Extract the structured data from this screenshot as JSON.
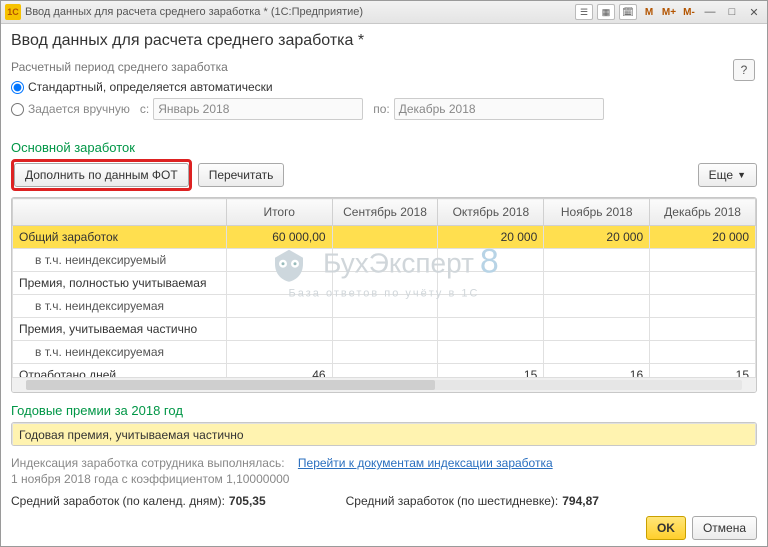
{
  "titlebar": {
    "logo_text": "1C",
    "title": "Ввод данных для расчета среднего заработка * (1С:Предприятие)",
    "m_labels": [
      "M",
      "M+",
      "M-"
    ]
  },
  "header": "Ввод данных для расчета среднего заработка *",
  "period": {
    "label": "Расчетный период среднего заработка",
    "opt_standard": "Стандартный, определяется автоматически",
    "opt_manual": "Задается вручную",
    "from_label": "с:",
    "to_label": "по:",
    "from_value": "Январь 2018",
    "to_value": "Декабрь 2018"
  },
  "help": "?",
  "main_section": {
    "title": "Основной заработок",
    "btn_fill": "Дополнить по данным ФОТ",
    "btn_recalc": "Перечитать",
    "btn_more": "Еще"
  },
  "chart_data": {
    "type": "table",
    "columns": [
      "",
      "Итого",
      "Сентябрь 2018",
      "Октябрь 2018",
      "Ноябрь 2018",
      "Декабрь 2018"
    ],
    "rows": [
      {
        "name": "Общий заработок",
        "total": "60 000,00",
        "sep": "",
        "oct": "20 000",
        "nov": "20 000",
        "dec": "20 000",
        "cls": "total"
      },
      {
        "name": "в т.ч. неиндексируемый",
        "total": "",
        "sep": "",
        "oct": "",
        "nov": "",
        "dec": "",
        "cls": "sub"
      },
      {
        "name": "Премия, полностью учитываемая",
        "total": "",
        "sep": "",
        "oct": "",
        "nov": "",
        "dec": "",
        "cls": ""
      },
      {
        "name": "в т.ч. неиндексируемая",
        "total": "",
        "sep": "",
        "oct": "",
        "nov": "",
        "dec": "",
        "cls": "sub"
      },
      {
        "name": "Премия, учитываемая частично",
        "total": "",
        "sep": "",
        "oct": "",
        "nov": "",
        "dec": "",
        "cls": ""
      },
      {
        "name": "в т.ч. неиндексируемая",
        "total": "",
        "sep": "",
        "oct": "",
        "nov": "",
        "dec": "",
        "cls": "sub"
      },
      {
        "name": "Отработано дней",
        "total": "46",
        "sep": "",
        "oct": "15",
        "nov": "16",
        "dec": "15",
        "cls": ""
      }
    ]
  },
  "annual": {
    "title": "Годовые премии за 2018 год",
    "row": "Годовая премия, учитываемая частично"
  },
  "indexation": {
    "line1_a": "Индексация заработка сотрудника выполнялась:",
    "link": "Перейти к документам индексации заработка",
    "line2": "1 ноября 2018 года с коэффициентом 1,10000000"
  },
  "averages": {
    "cal_label": "Средний заработок (по календ. дням):",
    "cal_value": "705,35",
    "six_label": "Средний заработок (по шестидневке):",
    "six_value": "794,87"
  },
  "footer": {
    "ok": "OK",
    "cancel": "Отмена"
  },
  "watermark": {
    "t1": "БухЭксперт",
    "eight": "8",
    "t2": "База ответов по учёту в 1С"
  }
}
